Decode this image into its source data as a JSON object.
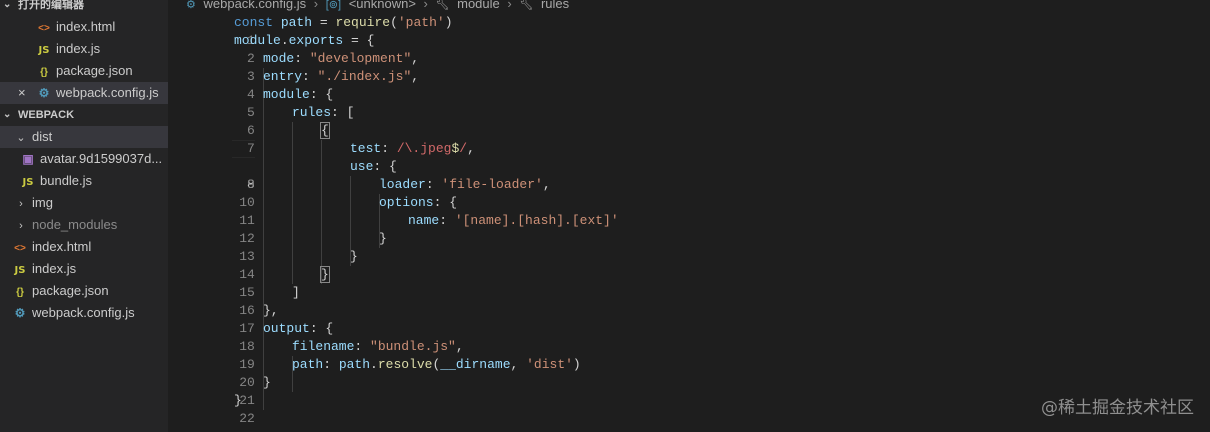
{
  "sidebar": {
    "open_editors_title": "打开的编辑器",
    "open_editors": [
      {
        "icon": "<>",
        "label": "index.html"
      },
      {
        "icon": "JS",
        "label": "index.js"
      },
      {
        "icon": "{}",
        "label": "package.json"
      },
      {
        "icon": "⚙",
        "label": "webpack.config.js"
      }
    ],
    "project_title": "WEBPACK",
    "tree": {
      "dist": "dist",
      "avatar": "avatar.9d1599037d...",
      "bundle": "bundle.js",
      "img": "img",
      "node_modules": "node_modules",
      "index_html": "index.html",
      "index_js": "index.js",
      "package_json": "package.json",
      "webpack_config": "webpack.config.js"
    },
    "icons": {
      "html": "<>",
      "js": "JS",
      "json": "{}",
      "webpack": "⚙",
      "image": "▣"
    }
  },
  "breadcrumb": {
    "file": "webpack.config.js",
    "unknown": "<unknown>",
    "module": "module",
    "rules": "rules"
  },
  "code": {
    "line_numbers": [
      "1",
      "2",
      "3",
      "4",
      "5",
      "6",
      "7",
      "8",
      "9",
      "10",
      "11",
      "12",
      "13",
      "14",
      "15",
      "16",
      "17",
      "18",
      "19",
      "20",
      "21",
      "22"
    ],
    "l1": {
      "kw": "const",
      "var": "path",
      "eq": " = ",
      "fn": "require",
      "open": "(",
      "str": "'path'",
      "close": ")"
    },
    "l2": {
      "var": "module",
      "dot": ".",
      "prop": "exports",
      "rest": " = {"
    },
    "l3": {
      "key": "mode",
      "colon": ": ",
      "str": "\"development\"",
      "comma": ","
    },
    "l4": {
      "key": "entry",
      "colon": ": ",
      "str": "\"./index.js\"",
      "comma": ","
    },
    "l5": {
      "key": "module",
      "rest": ": {"
    },
    "l6": {
      "key": "rules",
      "rest": ": ["
    },
    "l7": {
      "brace": "{"
    },
    "l8": {
      "key": "test",
      "colon": ": ",
      "rx1": "/\\.",
      "rx2": "jpeg",
      "rx3": "$",
      "rx4": "/",
      "comma": ","
    },
    "l9": {
      "key": "use",
      "rest": ": {"
    },
    "l10": {
      "key": "loader",
      "colon": ": ",
      "str": "'file-loader'",
      "comma": ","
    },
    "l11": {
      "key": "options",
      "rest": ": {"
    },
    "l12": {
      "key": "name",
      "colon": ": ",
      "str": "'[name].[hash].[ext]'"
    },
    "l13": {
      "brace": "}"
    },
    "l14": {
      "brace": "}"
    },
    "l15": {
      "brace": "}"
    },
    "l16": {
      "brace": "]"
    },
    "l17": {
      "brace": "},"
    },
    "l18": {
      "key": "output",
      "rest": ": {"
    },
    "l19": {
      "key": "filename",
      "colon": ": ",
      "str": "\"bundle.js\"",
      "comma": ","
    },
    "l20": {
      "key": "path",
      "colon": ": ",
      "var": "path",
      "dot": ".",
      "fn": "resolve",
      "open": "(",
      "var2": "__dirname",
      "sep": ", ",
      "str": "'dist'",
      "close": ")"
    },
    "l21": {
      "brace": "}"
    },
    "l22": {
      "brace": "}"
    }
  },
  "watermark": "@稀土掘金技术社区"
}
